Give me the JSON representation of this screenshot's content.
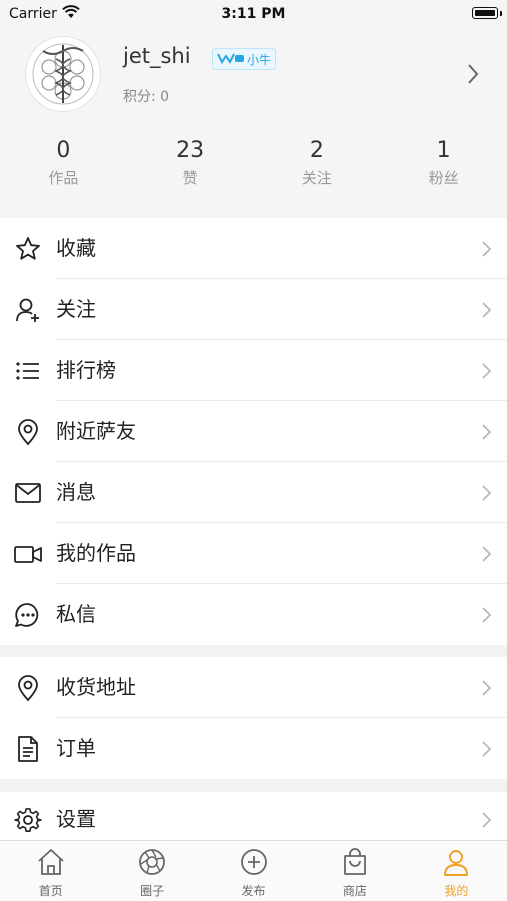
{
  "status_bar": {
    "carrier": "Carrier",
    "time": "3:11 PM"
  },
  "profile": {
    "username": "jet_shi",
    "level_name": "小牛",
    "points": "积分: 0",
    "stats": [
      {
        "value": "0",
        "label": "作品"
      },
      {
        "value": "23",
        "label": "赞"
      },
      {
        "value": "2",
        "label": "关注"
      },
      {
        "value": "1",
        "label": "粉丝"
      }
    ]
  },
  "menu": {
    "group1": [
      {
        "label": "收藏",
        "icon": "star-icon"
      },
      {
        "label": "关注",
        "icon": "person-add-icon"
      },
      {
        "label": "排行榜",
        "icon": "list-icon"
      },
      {
        "label": "附近萨友",
        "icon": "location-pin-icon"
      },
      {
        "label": "消息",
        "icon": "envelope-icon"
      },
      {
        "label": "我的作品",
        "icon": "video-camera-icon"
      },
      {
        "label": "私信",
        "icon": "chat-bubble-icon"
      }
    ],
    "group2": [
      {
        "label": "收货地址",
        "icon": "location-pin-icon"
      },
      {
        "label": "订单",
        "icon": "document-icon"
      }
    ],
    "group3": [
      {
        "label": "设置",
        "icon": "gear-icon"
      }
    ]
  },
  "tabbar": {
    "tabs": [
      {
        "label": "首页",
        "icon": "home-icon"
      },
      {
        "label": "圈子",
        "icon": "aperture-icon"
      },
      {
        "label": "发布",
        "icon": "plus-circle-icon"
      },
      {
        "label": "商店",
        "icon": "shopping-bag-icon"
      },
      {
        "label": "我的",
        "icon": "person-icon"
      }
    ],
    "active_color": "#f0a020"
  }
}
